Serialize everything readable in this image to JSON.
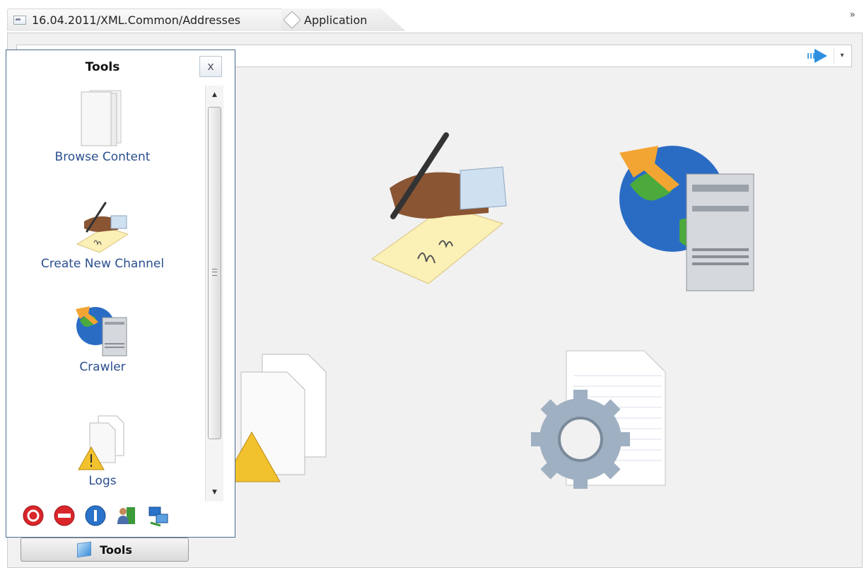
{
  "tabs": [
    {
      "label": "16.04.2011/XML.Common/Addresses",
      "icon": "document-icon"
    },
    {
      "label": "Application",
      "icon": "application-tag-icon"
    }
  ],
  "overflow_glyph": "»",
  "toolbar": {
    "go_icon": "go-arrow-icon",
    "dropdown_glyph": "▾"
  },
  "tools_panel": {
    "title": "Tools",
    "close_glyph": "x",
    "items": [
      {
        "label": "Browse Content",
        "icon": "blank-pages-icon"
      },
      {
        "label": "Create New Channel",
        "icon": "signing-hand-icon"
      },
      {
        "label": "Crawler",
        "icon": "globe-server-icon"
      },
      {
        "label": "Logs",
        "icon": "warning-documents-icon"
      }
    ],
    "quick_actions": [
      {
        "icon": "power-icon",
        "color": "#d9262b"
      },
      {
        "icon": "stop-icon",
        "color": "#d9262b"
      },
      {
        "icon": "pause-icon",
        "color": "#2a73c9"
      },
      {
        "icon": "user-exit-icon",
        "color": "#3c9a3a"
      },
      {
        "icon": "network-icon",
        "color": "#2a73c9"
      }
    ],
    "scroll": {
      "up_glyph": "▲",
      "down_glyph": "▼"
    }
  },
  "tools_button": {
    "label": "Tools",
    "icon": "tools-panel-icon"
  },
  "colors": {
    "link_text": "#2a4f8f",
    "panel_border": "#4a6b8a",
    "workspace_bg": "#f1f1f1"
  }
}
